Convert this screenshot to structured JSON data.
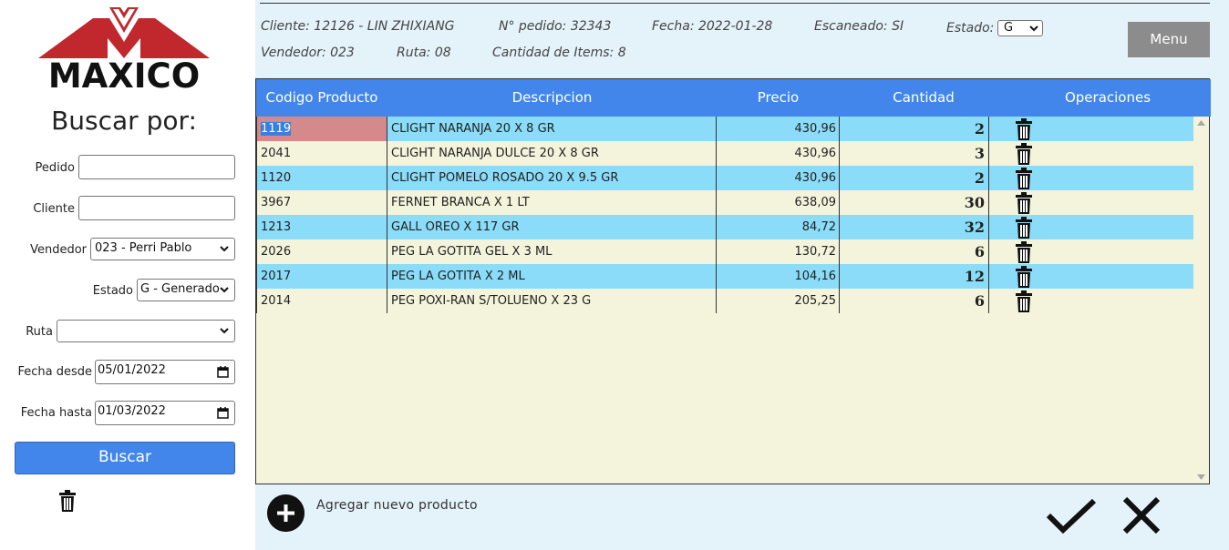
{
  "sidebar": {
    "logo_text": "MAXICO",
    "search_title": "Buscar por:",
    "fields": {
      "pedido_label": "Pedido",
      "pedido_value": "",
      "cliente_label": "Cliente",
      "cliente_value": "",
      "vendedor_label": "Vendedor",
      "vendedor_value": "023 - Perri Pablo",
      "estado_label": "Estado",
      "estado_value": "G - Generado",
      "ruta_label": "Ruta",
      "ruta_value": "",
      "fecha_desde_label": "Fecha desde",
      "fecha_desde_value": "05/01/2022",
      "fecha_hasta_label": "Fecha hasta",
      "fecha_hasta_value": "01/03/2022"
    },
    "search_button": "Buscar"
  },
  "header": {
    "cliente": "Cliente: 12126 - LIN ZHIXIANG",
    "pedido": "N° pedido: 32343",
    "fecha": "Fecha: 2022-01-28",
    "escaneado": "Escaneado: SI",
    "estado_label": "Estado:",
    "estado_value": "G",
    "vendedor": "Vendedor: 023",
    "ruta": "Ruta: 08",
    "cantidad_items": "Cantidad de Items: 8",
    "menu_button": "Menu"
  },
  "table": {
    "columns": [
      "Codigo Producto",
      "Descripcion",
      "Precio",
      "Cantidad",
      "Operaciones"
    ],
    "rows": [
      {
        "code": "1119",
        "desc": "CLIGHT NARANJA 20 X 8 GR",
        "price": "430,96",
        "qty": "2"
      },
      {
        "code": "2041",
        "desc": "CLIGHT NARANJA DULCE 20 X 8 GR",
        "price": "430,96",
        "qty": "3"
      },
      {
        "code": "1120",
        "desc": "CLIGHT POMELO ROSADO 20 X 9.5 GR",
        "price": "430,96",
        "qty": "2"
      },
      {
        "code": "3967",
        "desc": "FERNET BRANCA X 1 LT",
        "price": "638,09",
        "qty": "30"
      },
      {
        "code": "1213",
        "desc": "GALL OREO X 117 GR",
        "price": "84,72",
        "qty": "32"
      },
      {
        "code": "2026",
        "desc": "PEG LA GOTITA GEL X 3 ML",
        "price": "130,72",
        "qty": "6"
      },
      {
        "code": "2017",
        "desc": "PEG LA GOTITA X 2 ML",
        "price": "104,16",
        "qty": "12"
      },
      {
        "code": "2014",
        "desc": "PEG POXI-RAN S/TOLUENO X 23 G",
        "price": "205,25",
        "qty": "6"
      }
    ]
  },
  "footer": {
    "add_label": "Agregar nuevo producto"
  },
  "colors": {
    "accent": "#4286ec",
    "row_blue": "#8bdcf8",
    "row_cream": "#f4f4dd",
    "selected_cell": "#d48a8a",
    "logo_red": "#c0282d"
  },
  "icons": [
    "trash-icon",
    "add-icon",
    "check-icon",
    "close-icon",
    "calendar-icon",
    "chevron-down-icon"
  ]
}
